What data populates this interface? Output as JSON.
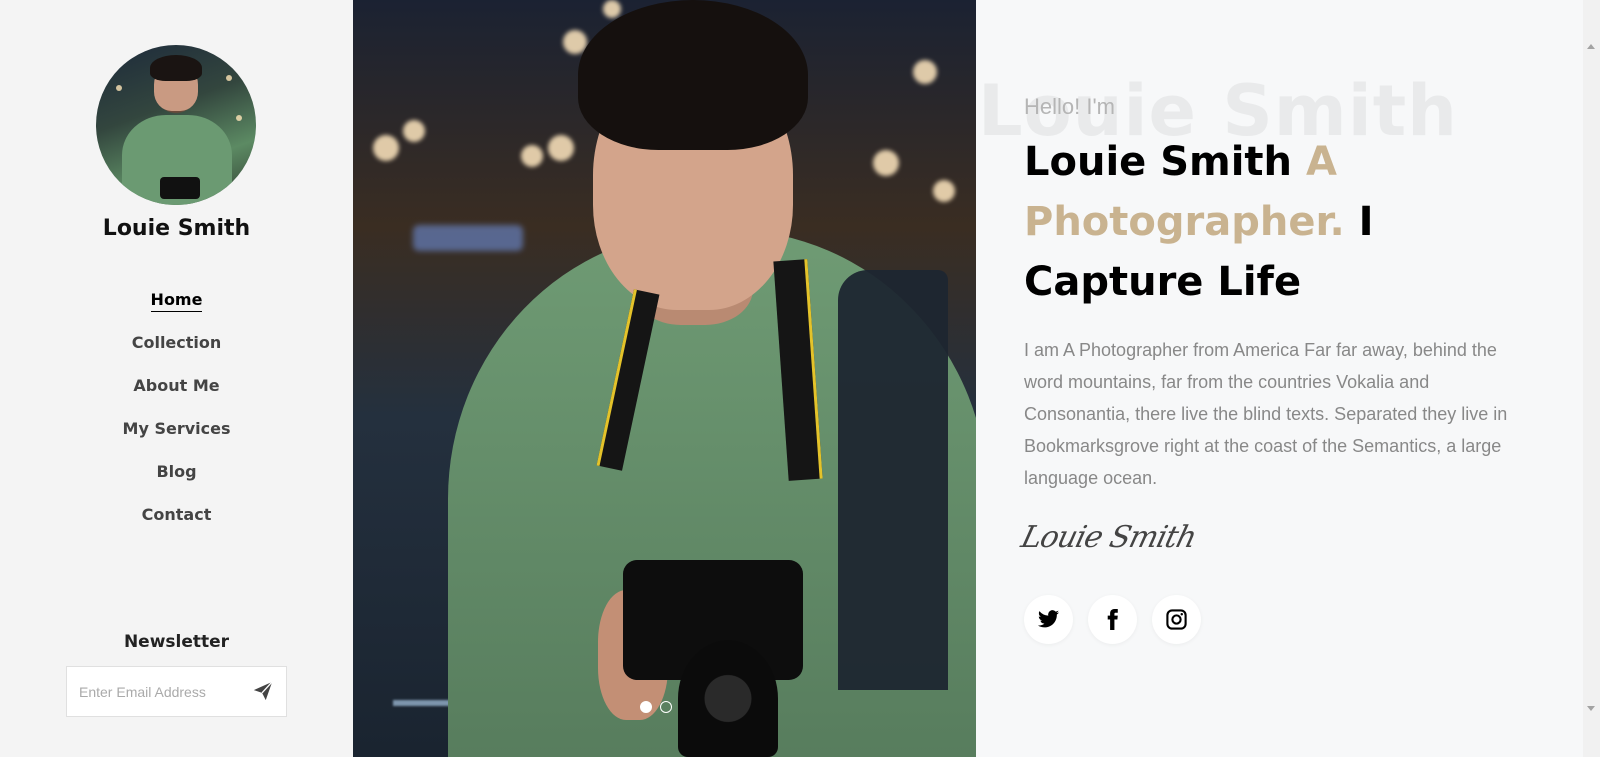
{
  "sidebar": {
    "name": "Louie Smith",
    "nav": [
      {
        "label": "Home",
        "active": true
      },
      {
        "label": "Collection",
        "active": false
      },
      {
        "label": "About Me",
        "active": false
      },
      {
        "label": "My Services",
        "active": false
      },
      {
        "label": "Blog",
        "active": false
      },
      {
        "label": "Contact",
        "active": false
      }
    ],
    "newsletter": {
      "title": "Newsletter",
      "placeholder": "Enter Email Address",
      "send_icon": "paper-plane-icon"
    }
  },
  "hero": {
    "slides": 2,
    "active_slide": 1
  },
  "content": {
    "ghost_text": "Louie Smith",
    "greeting": "Hello! I'm",
    "headline": {
      "name": "Louie Smith",
      "role": "A Photographer.",
      "tagline_1": "I",
      "tagline_2": "Capture Life"
    },
    "bio": "I am A Photographer from America Far far away, behind the word mountains, far from the countries Vokalia and Consonantia, there live the blind texts. Separated they live in Bookmarksgrove right at the coast of the Semantics, a large language ocean.",
    "signature": "Louie Smith",
    "socials": [
      {
        "icon": "twitter-icon"
      },
      {
        "icon": "facebook-icon"
      },
      {
        "icon": "instagram-icon"
      }
    ]
  },
  "colors": {
    "accent": "#c9b390",
    "heading": "#000000",
    "body_text": "#888888",
    "sidebar_bg": "#f4f4f4",
    "content_bg": "#f7f8f9"
  }
}
